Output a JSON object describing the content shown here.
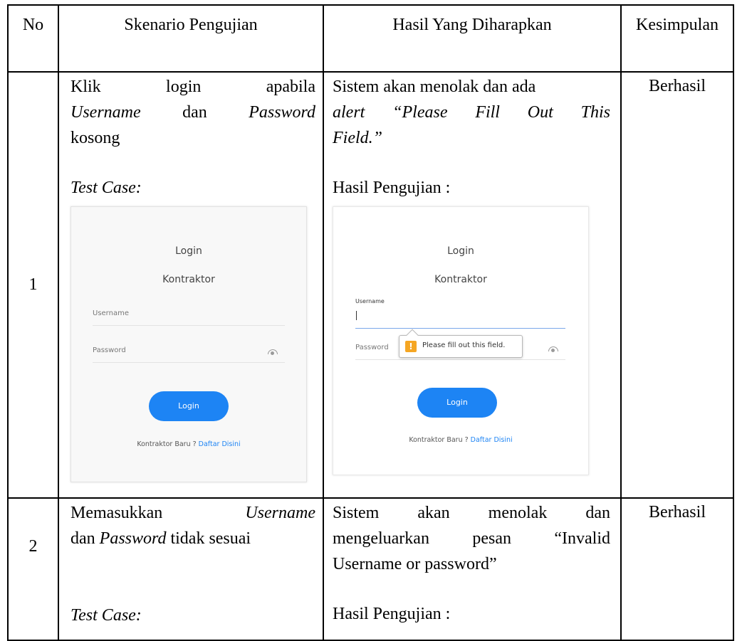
{
  "headers": {
    "no": "No",
    "scenario": "Skenario Pengujian",
    "expected": "Hasil Yang Diharapkan",
    "conclusion": "Kesimpulan"
  },
  "rows": [
    {
      "no": "1",
      "scenario_line1": "Klik login apabila",
      "scenario_line2_a": "Username",
      "scenario_line2_b": " dan ",
      "scenario_line2_c": "Password",
      "scenario_line3": "kosong",
      "testcase_label": "Test Case:",
      "expected_line1": "Sistem akan menolak dan ada",
      "expected_line2": "alert “Please Fill Out This",
      "expected_line3": "Field.”",
      "result_label": "Hasil Pengujian :",
      "conclusion": "Berhasil"
    },
    {
      "no": "2",
      "scenario_line1_a": "Memasukkan",
      "scenario_line1_b": "Username",
      "scenario_line2_a": "dan ",
      "scenario_line2_b": "Password",
      "scenario_line2_c": " tidak sesuai",
      "testcase_label": "Test Case:",
      "expected_line1": "Sistem akan menolak dan",
      "expected_line2": "mengeluarkan pesan “Invalid",
      "expected_line3": "Username or password”",
      "result_label": "Hasil Pengujian :",
      "conclusion": "Berhasil"
    }
  ],
  "login_screen": {
    "title": "Login",
    "subtitle": "Kontraktor",
    "username_label": "Username",
    "password_label": "Password",
    "login_button": "Login",
    "register_text": "Kontraktor Baru ? ",
    "register_link": "Daftar Disini"
  },
  "validation_tooltip": {
    "icon": "!",
    "message": "Please fill out this field."
  },
  "colors": {
    "button_blue": "#1d84f4",
    "warning_orange": "#f5a623"
  }
}
